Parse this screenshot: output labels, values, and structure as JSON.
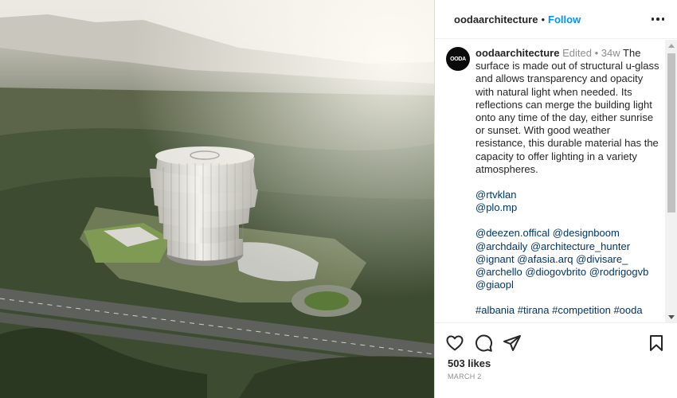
{
  "post": {
    "username": "oodaarchitecture",
    "follow_label": "Follow",
    "separator": "•",
    "avatar_text": "OODA",
    "photo_alt": "Aerial rendering of a spiral glass building surrounded by forested hills"
  },
  "caption": {
    "username": "oodaarchitecture",
    "edited": "Edited",
    "separator": "•",
    "age": "34w",
    "text": "The surface is made out of structural u-glass and allows transparency and opacity with natural light when needed. Its reflections can merge the building light onto any time of the day, either sunrise or sunset. With good weather resistance, this durable material has the capacity to offer lighting in a variety atmospheres.",
    "mentions_1": [
      "@rtvklan",
      "@plo.mp"
    ],
    "mentions_2": "@deezen.offical @designboom @archdaily @architecture_hunter @ignant @afasia.arq @divisare_ @archello @diogovbrito @rodrigogvb @giaopl",
    "hashtags": "#albania #tirana #competition #ooda"
  },
  "footer": {
    "likes": "503 likes",
    "date": "MARCH 2"
  },
  "icons": [
    "heart-icon",
    "comment-icon",
    "share-icon",
    "bookmark-icon",
    "more-options-icon"
  ]
}
